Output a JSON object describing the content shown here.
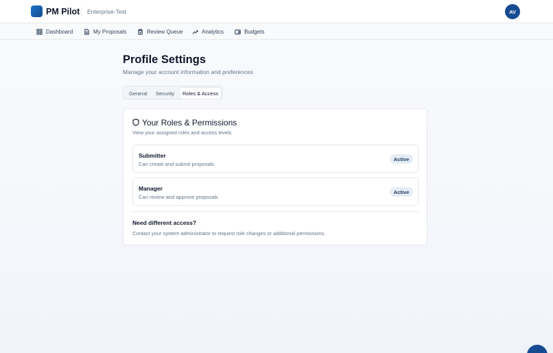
{
  "header": {
    "app_name": "PM Pilot",
    "workspace": "Enterprise-Test",
    "avatar_initials": "AV"
  },
  "nav": {
    "items": [
      {
        "label": "Dashboard",
        "icon": "grid-icon"
      },
      {
        "label": "My Proposals",
        "icon": "document-icon"
      },
      {
        "label": "Review Queue",
        "icon": "clipboard-icon"
      },
      {
        "label": "Analytics",
        "icon": "trend-icon"
      },
      {
        "label": "Budgets",
        "icon": "wallet-icon"
      }
    ]
  },
  "page": {
    "title": "Profile Settings",
    "subtitle": "Manage your account information and preferences"
  },
  "tabs": [
    {
      "label": "General",
      "active": false
    },
    {
      "label": "Security",
      "active": false
    },
    {
      "label": "Roles & Access",
      "active": true
    }
  ],
  "roles_card": {
    "title": "Your Roles & Permissions",
    "subtitle": "View your assigned roles and access levels",
    "roles": [
      {
        "name": "Submitter",
        "description": "Can create and submit proposals",
        "status": "Active"
      },
      {
        "name": "Manager",
        "description": "Can review and approve proposals",
        "status": "Active"
      }
    ],
    "access_title": "Need different access?",
    "access_description": "Contact your system administrator to request role changes or additional permissions."
  },
  "colors": {
    "brand": "#164b91",
    "badge_bg": "#e6edf6"
  }
}
